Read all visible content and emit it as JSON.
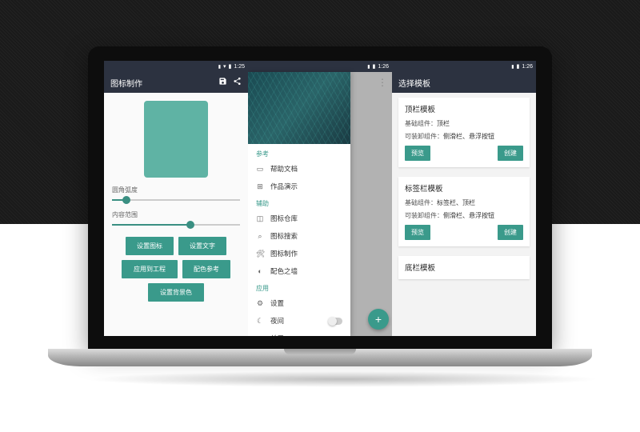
{
  "status_time": "1:25",
  "status_time2": "1:26",
  "pane1": {
    "title": "图标制作",
    "slider1_label": "圆角弧度",
    "slider2_label": "内容范围",
    "buttons": {
      "b1": "设置图标",
      "b2": "设置文字",
      "b3": "应用到工程",
      "b4": "配色参考",
      "b5": "设置背景色"
    }
  },
  "pane2": {
    "sections": {
      "ref": "参考",
      "aux": "辅助",
      "app": "应用"
    },
    "items": {
      "help_doc": "帮助文档",
      "demo": "作品演示",
      "icon_lib": "图标仓库",
      "icon_search": "图标搜索",
      "icon_make": "图标制作",
      "palette": "配色之墙",
      "settings": "设置",
      "night": "夜间",
      "about": "关于"
    }
  },
  "pane3": {
    "title": "选择模板",
    "field_base": "基础组件：",
    "field_opt": "可装卸组件：",
    "preview": "预览",
    "create": "创建",
    "cards": [
      {
        "name": "顶栏模板",
        "base": "顶栏",
        "opt": "侧滑栏、悬浮按钮"
      },
      {
        "name": "标签栏模板",
        "base": "标签栏、顶栏",
        "opt": "侧滑栏、悬浮按钮"
      },
      {
        "name": "底栏模板",
        "base": "",
        "opt": ""
      }
    ]
  }
}
